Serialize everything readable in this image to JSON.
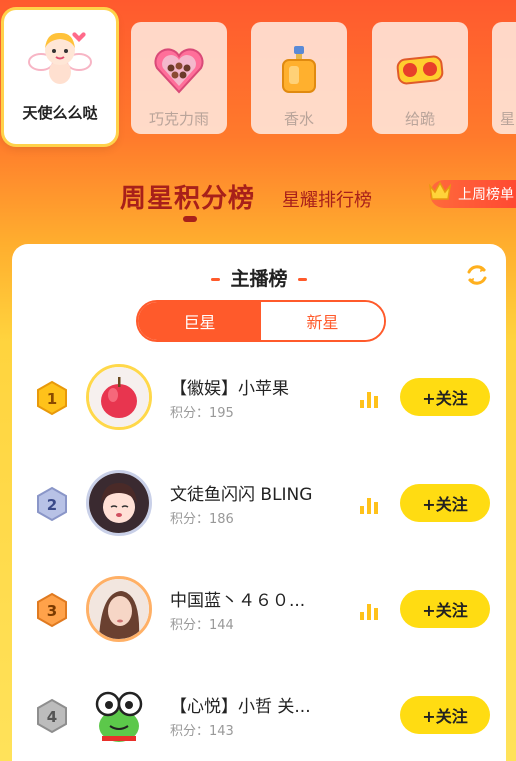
{
  "gifts": [
    {
      "name": "天使么么哒",
      "icon": "cupid-angel-icon",
      "selected": true
    },
    {
      "name": "巧克力雨",
      "icon": "chocolate-box-icon",
      "selected": false
    },
    {
      "name": "香水",
      "icon": "perfume-bottle-icon",
      "selected": false
    },
    {
      "name": "给跪",
      "icon": "kneel-text-icon",
      "selected": false
    },
    {
      "name": "星",
      "icon": "partial-gift-icon",
      "selected": false
    }
  ],
  "rank_tabs": {
    "active": "周星积分榜",
    "other": "星耀排行榜",
    "last_week": "上周榜单"
  },
  "card": {
    "title": "主播榜",
    "segments": [
      "巨星",
      "新星"
    ],
    "active_segment": "巨星"
  },
  "colors": {
    "accent": "#ff5a2b",
    "tab_text": "#a8201a",
    "follow_button": "#ffdc12"
  },
  "ranking": [
    {
      "rank": "1",
      "name": "【徽娱】小苹果",
      "score": "积分：195",
      "follow": "+关注",
      "avatar": "apple-avatar"
    },
    {
      "rank": "2",
      "name": "文徒鱼闪闪 BLING",
      "score": "积分：186",
      "follow": "+关注",
      "avatar": "anime-girl-avatar"
    },
    {
      "rank": "3",
      "name": "中国蓝丶４６０...",
      "score": "积分：144",
      "follow": "+关注",
      "avatar": "girl-photo-avatar"
    },
    {
      "rank": "4",
      "name": "【心悦】小哲 关...",
      "score": "积分：143",
      "follow": "+关注",
      "avatar": "frog-avatar"
    }
  ]
}
